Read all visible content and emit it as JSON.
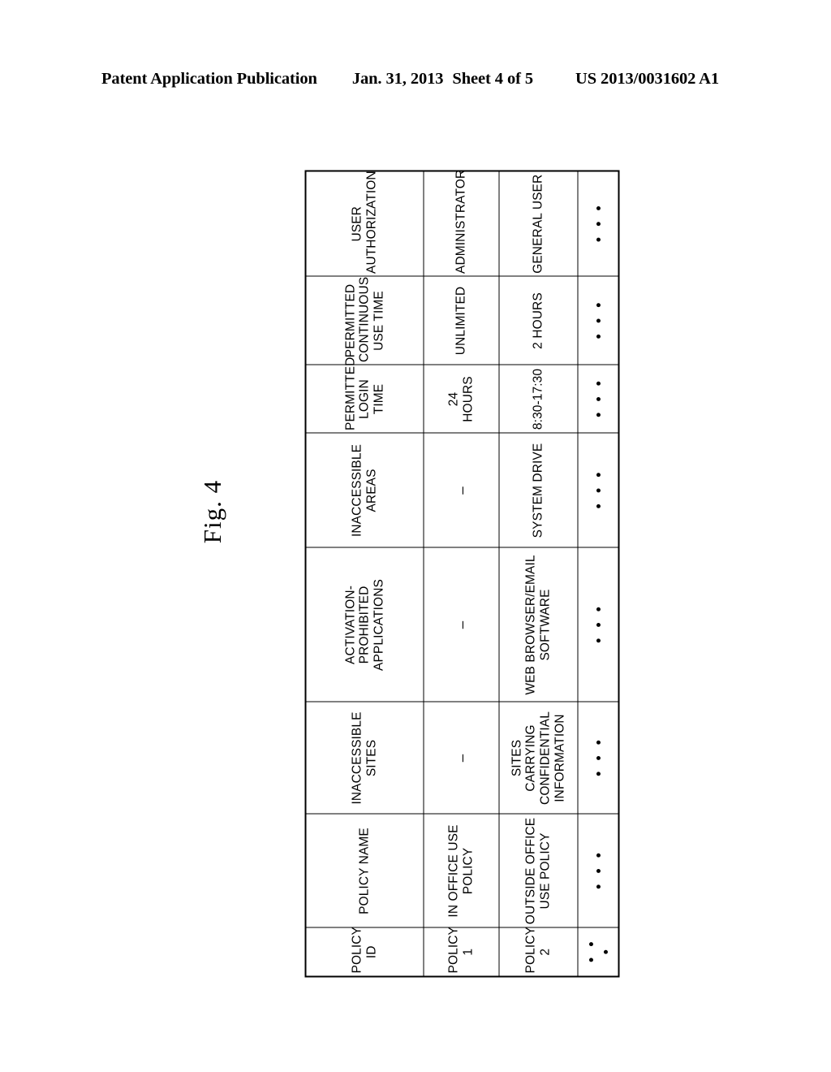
{
  "header": {
    "publication": "Patent Application Publication",
    "date": "Jan. 31, 2013",
    "sheet": "Sheet 4 of 5",
    "document_number": "US 2013/0031602 A1"
  },
  "figure": {
    "label": "Fig. 4"
  },
  "table": {
    "columns": [
      "POLICY\nID",
      "POLICY NAME",
      "INACCESSIBLE\nSITES",
      "ACTIVATION-PROHIBITED\nAPPLICATIONS",
      "INACCESSIBLE\nAREAS",
      "PERMITTED\nLOGIN TIME",
      "PERMITTED\nCONTINUOUS\nUSE TIME",
      "USER\nAUTHORIZATION"
    ],
    "rows": [
      {
        "policy_id": "POLICY\n1",
        "policy_name": "IN OFFICE USE\nPOLICY",
        "inaccessible_sites": "–",
        "activation_prohibited_applications": "–",
        "inaccessible_areas": "–",
        "permitted_login_time": "24 HOURS",
        "permitted_continuous_use_time": "UNLIMITED",
        "user_authorization": "ADMINISTRATOR"
      },
      {
        "policy_id": "POLICY\n2",
        "policy_name": "OUTSIDE OFFICE\nUSE POLICY",
        "inaccessible_sites": "SITES CARRYING\nCONFIDENTIAL\nINFORMATION",
        "activation_prohibited_applications": "WEB BROWSER/EMAIL\nSOFTWARE",
        "inaccessible_areas": "SYSTEM DRIVE",
        "permitted_login_time": "8:30-17:30",
        "permitted_continuous_use_time": "2 HOURS",
        "user_authorization": "GENERAL USER"
      },
      {
        "policy_id": "• • •",
        "policy_name": "• • •",
        "inaccessible_sites": "• • •",
        "activation_prohibited_applications": "• • •",
        "inaccessible_areas": "• • •",
        "permitted_login_time": "• • •",
        "permitted_continuous_use_time": "• • •",
        "user_authorization": "• • •"
      }
    ]
  },
  "colors": {
    "ink": "#000000",
    "paper": "#ffffff"
  }
}
